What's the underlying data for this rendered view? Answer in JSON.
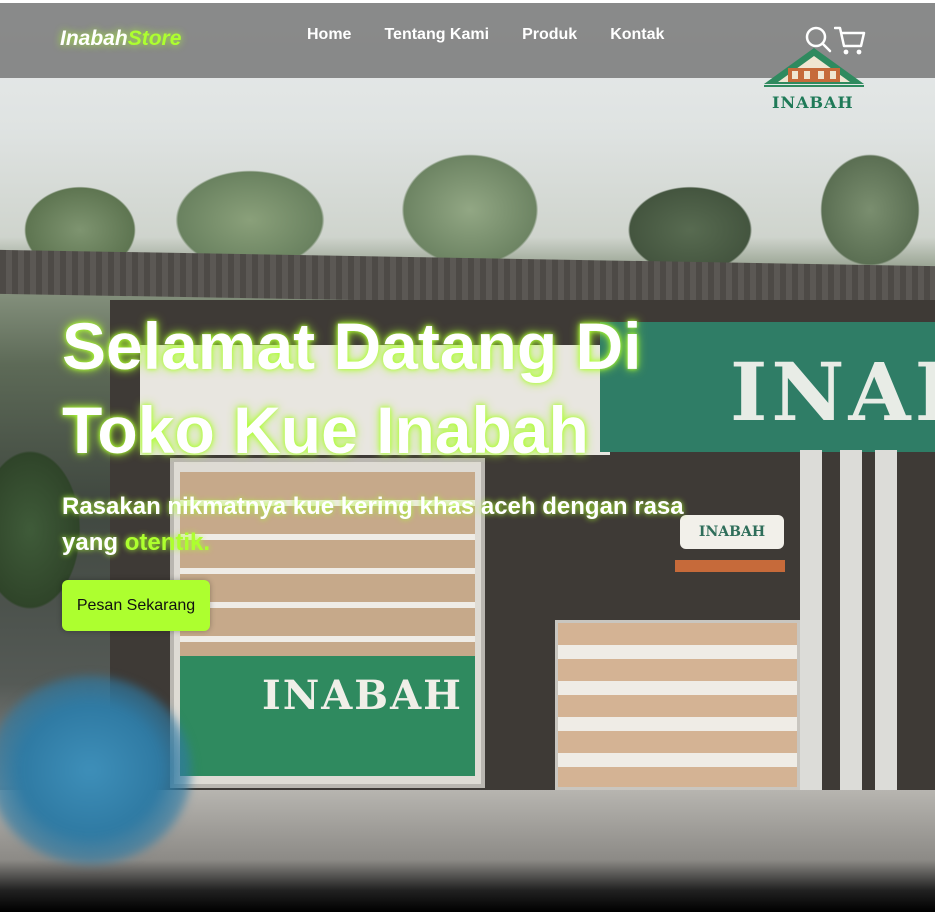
{
  "brand": {
    "name_main": "Inabah",
    "name_accent": "Store"
  },
  "nav": {
    "links": [
      {
        "label": "Home"
      },
      {
        "label": "Tentang Kami"
      },
      {
        "label": "Produk"
      },
      {
        "label": "Kontak"
      }
    ],
    "search_icon": "search-icon",
    "cart_icon": "shopping-cart-icon"
  },
  "logo": {
    "text": "INABAH"
  },
  "hero": {
    "title": "Selamat Datang Di Toko Kue Inabah",
    "subtitle_main": "Rasakan nikmatnya kue kering khas aceh dengan rasa yang ",
    "subtitle_highlight": "otentik.",
    "cta_label": "Pesan Sekarang"
  },
  "scene": {
    "shop_sign_text": "INAB",
    "cabinet_panel_text": "INABAH",
    "mini_sign_text": "INABAH"
  },
  "colors": {
    "accent": "#adff2f",
    "navbar_bg": "#6e6e6e",
    "sign_green": "#2f7d66"
  }
}
